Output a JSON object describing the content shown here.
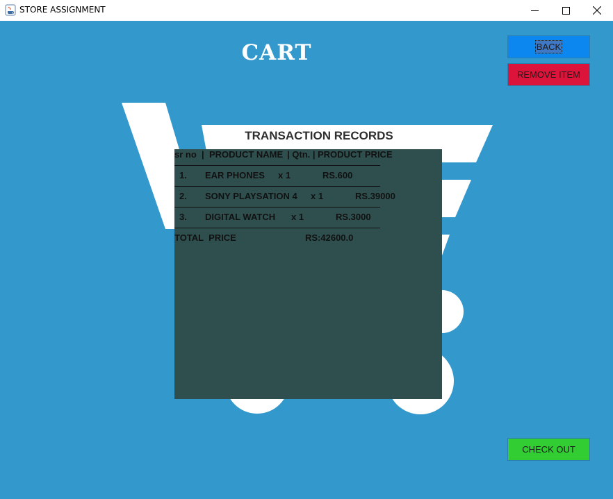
{
  "window": {
    "title": "STORE ASSIGNMENT",
    "controls": {
      "minimize": "minimize",
      "maximize": "maximize",
      "close": "close"
    }
  },
  "header": {
    "title": "CART"
  },
  "buttons": {
    "back": "BACK",
    "remove": "REMOVE ITEM",
    "checkout": "CHECK OUT"
  },
  "records": {
    "heading": "TRANSACTION RECORDS",
    "columns": {
      "sr": "sr no  |",
      "name": "PRODUCT NAME",
      "qty": "| Qtn. |",
      "price": "PRODUCT PRICE"
    },
    "rows": [
      {
        "sr": "1.",
        "name": "EAR PHONES",
        "qty": "x 1",
        "price": "RS.600"
      },
      {
        "sr": "2.",
        "name": "SONY PLAYSATION 4",
        "qty": "x 1",
        "price": "RS.39000"
      },
      {
        "sr": "3.",
        "name": "DIGITAL WATCH",
        "qty": "x 1",
        "price": "RS.3000"
      }
    ],
    "total_label": "TOTAL  PRICE",
    "total_value": "RS:42600.0"
  },
  "colors": {
    "background": "#3399cc",
    "panel": "#2f4f4f",
    "back_button": "#0d87f0",
    "remove_button": "#dc143c",
    "checkout_button": "#32cd32"
  },
  "icons": {
    "app": "java-cup-icon",
    "background_art": "shopping-cart-icon"
  }
}
